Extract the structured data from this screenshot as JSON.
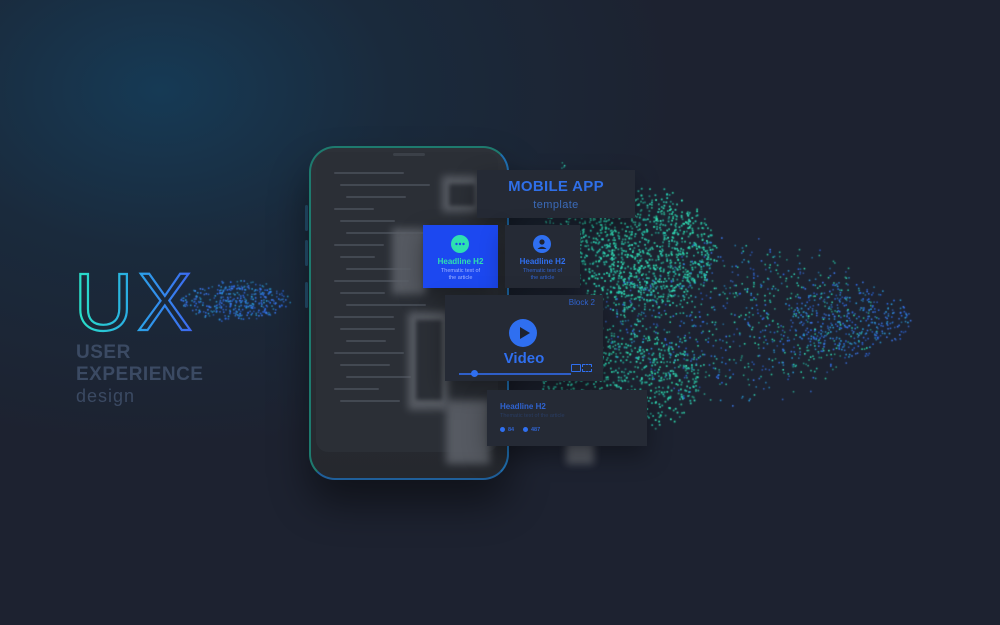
{
  "hero": {
    "logo_text": "UX",
    "line1": "USER",
    "line2": "EXPERIENCE",
    "line3": "design"
  },
  "mobile_card": {
    "title": "MOBILE APP",
    "subtitle": "template"
  },
  "tile_left": {
    "title": "Headline H2",
    "text_line1": "Thematic text of",
    "text_line2": "the article"
  },
  "tile_right": {
    "title": "Headline H2",
    "text_line1": "Thematic text of",
    "text_line2": "the article"
  },
  "video_card": {
    "block_label": "Block 2",
    "title": "Video"
  },
  "article_card": {
    "title": "Headline H2",
    "text": "Thematic text of the article",
    "comments": "84",
    "views": "487"
  },
  "icons": [
    "chat-bubble-icon",
    "user-icon",
    "play-icon",
    "fullscreen-icon",
    "settings-icon",
    "comment-icon",
    "eye-icon"
  ],
  "colors": {
    "background": "#1d2230",
    "accent_blue": "#2f6ff0",
    "accent_teal": "#2ee0b0",
    "card": "#252a35",
    "tile_blue": "#1c48f0"
  }
}
